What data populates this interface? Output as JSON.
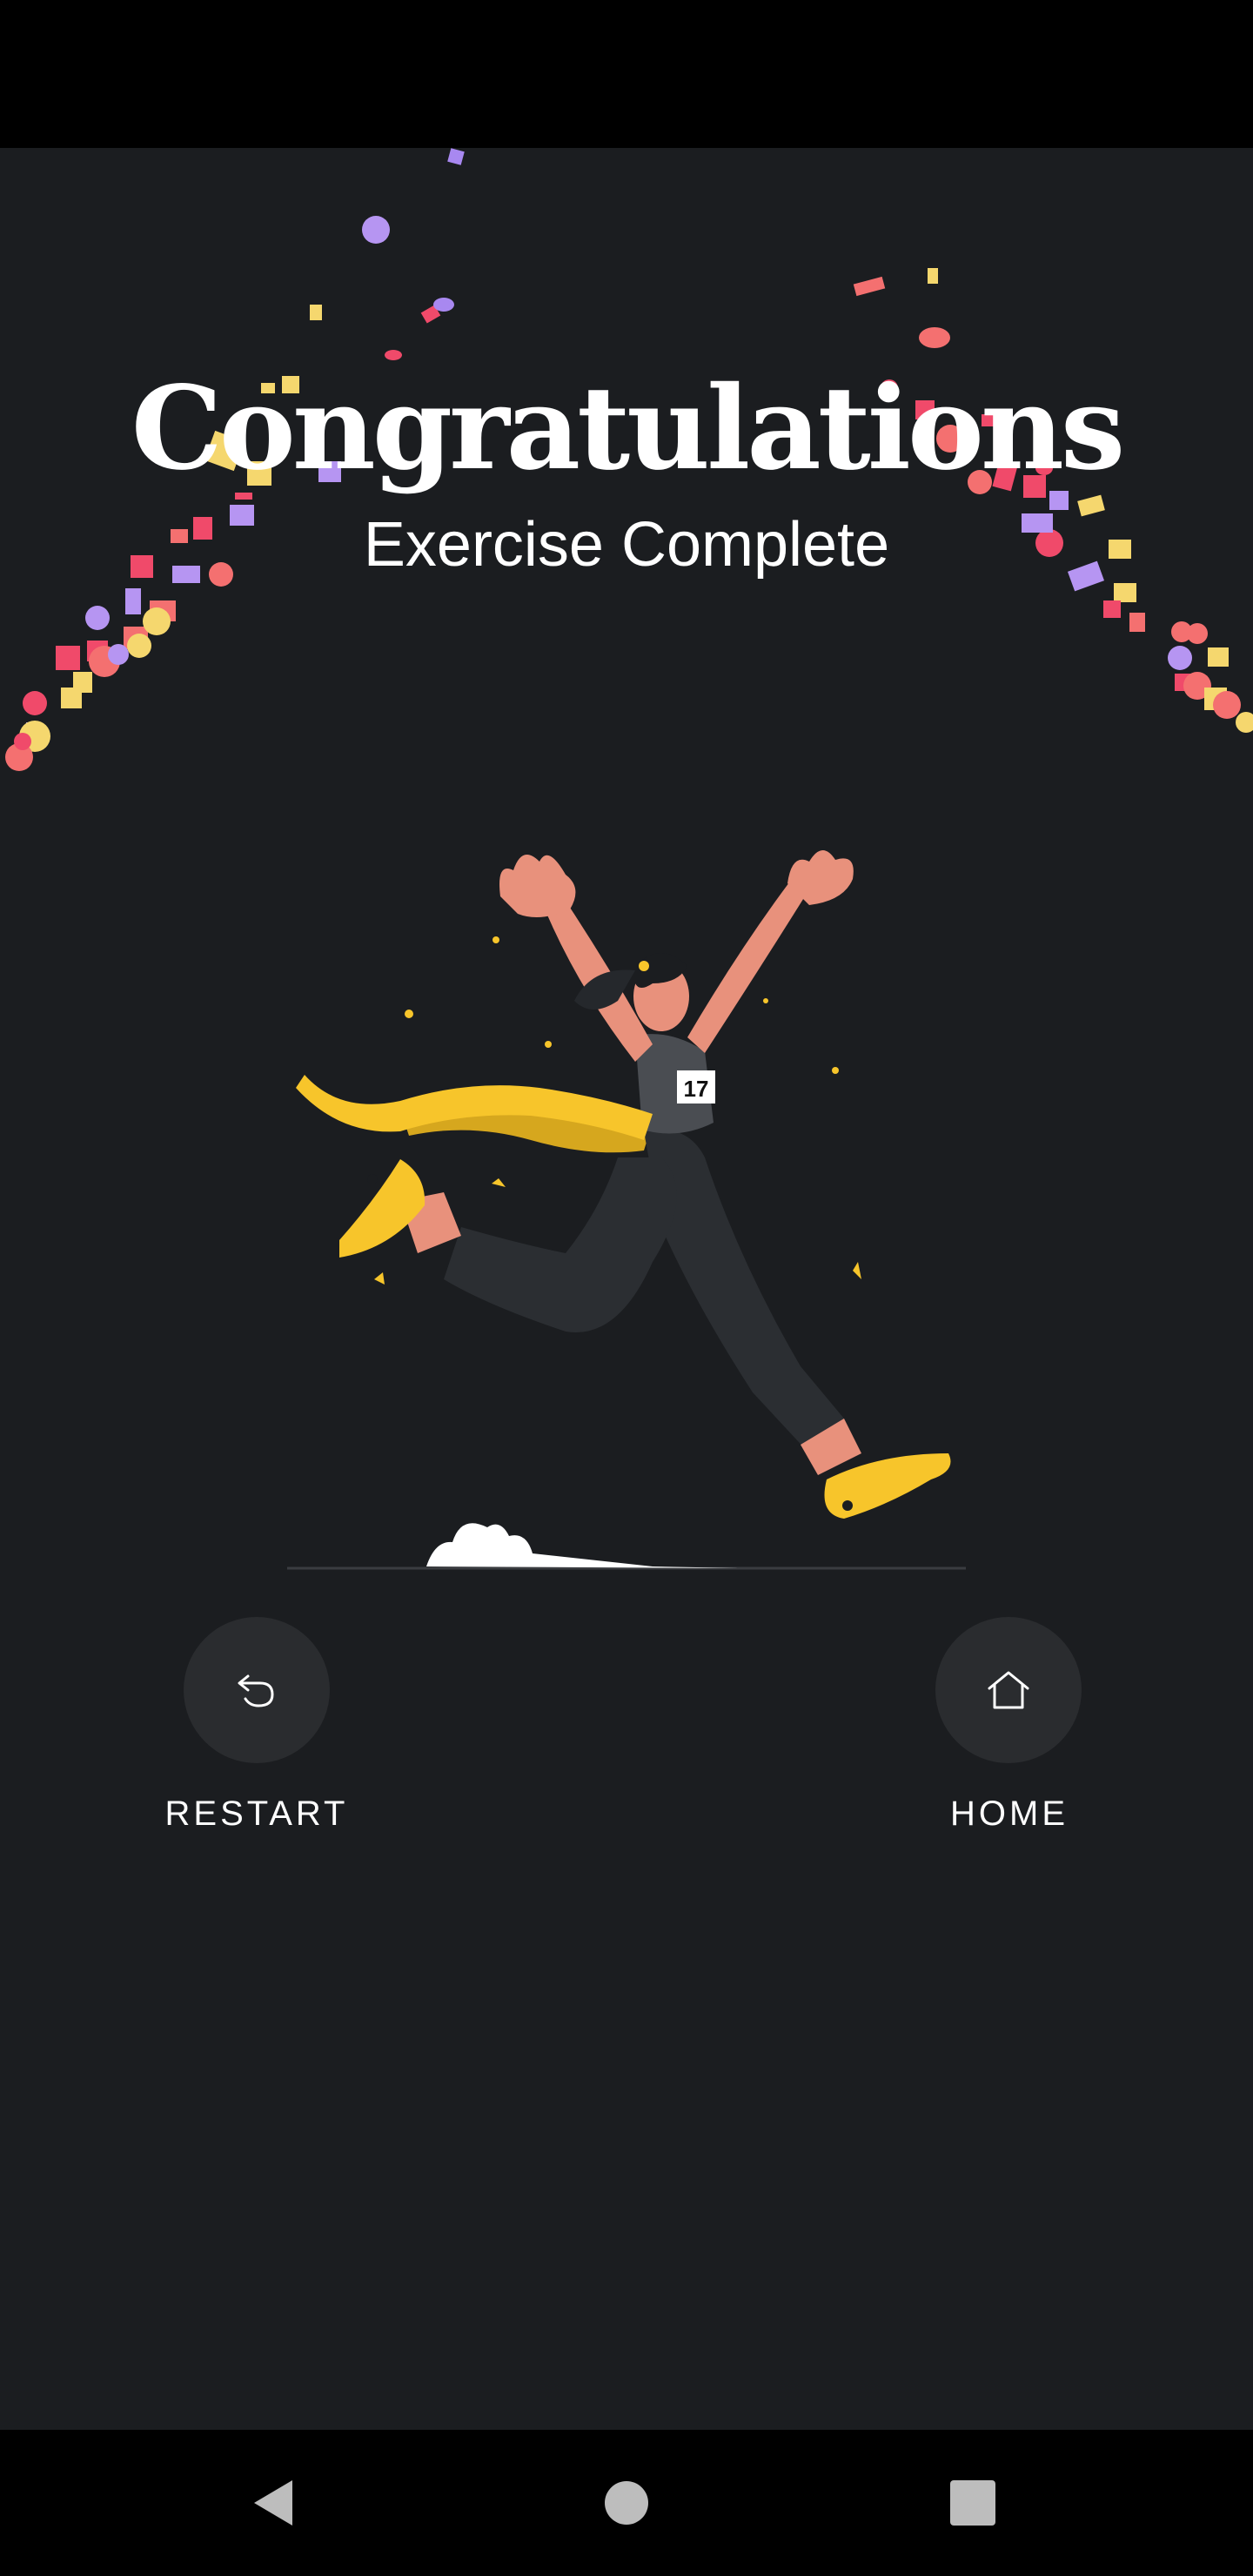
{
  "screen": {
    "title": "Congratulations",
    "subtitle": "Exercise Complete"
  },
  "illustration": {
    "bib_number": "17"
  },
  "actions": {
    "restart": {
      "label": "RESTART",
      "icon": "restart-icon"
    },
    "home": {
      "label": "HOME",
      "icon": "home-icon"
    }
  },
  "system_nav": {
    "back_icon": "back-icon",
    "home_icon": "home-circle-icon",
    "recents_icon": "recents-square-icon"
  },
  "colors": {
    "background": "#1b1d20",
    "accent_yellow": "#f7c52b",
    "skin": "#e8917c",
    "button_bg": "#2a2c2f"
  }
}
